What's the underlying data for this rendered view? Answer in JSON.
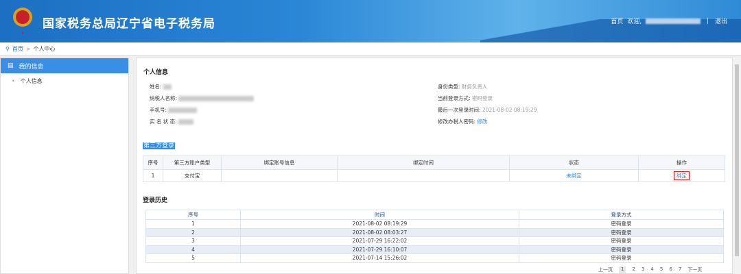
{
  "header": {
    "title": "国家税务总局辽宁省电子税务局",
    "emblem_text": "中国税务",
    "home": "首页",
    "welcome": "欢迎,",
    "logout": "退出"
  },
  "breadcrumb": {
    "home": "首页",
    "sep": ">",
    "current": "个人中心"
  },
  "sidebar": {
    "section": "我的信息",
    "items": [
      {
        "label": "个人信息"
      }
    ]
  },
  "personal": {
    "title": "个人信息",
    "left": [
      {
        "label": "姓名:"
      },
      {
        "label": "纳税人名称:"
      },
      {
        "label": "手机号:"
      },
      {
        "label": "实 名 状 态:"
      }
    ],
    "right": [
      {
        "label": "身份类型:",
        "value": "财务负责人"
      },
      {
        "label": "当前登录方式:",
        "value": "密码登录"
      },
      {
        "label": "最后一次登录时间:",
        "value": "2021-08-02 08:19:29"
      },
      {
        "label": "修改办税人密码:",
        "value": "修改"
      }
    ]
  },
  "third_party": {
    "title": "第三方登录",
    "headers": [
      "序号",
      "第三方账户类型",
      "绑定账号信息",
      "绑定时间",
      "状态",
      "操作"
    ],
    "rows": [
      {
        "no": "1",
        "type": "支付宝",
        "account": "",
        "time": "",
        "status": "未绑定",
        "action": "绑定"
      }
    ]
  },
  "history": {
    "title": "登录历史",
    "headers": [
      "序号",
      "时间",
      "登录方式"
    ],
    "rows": [
      {
        "no": "1",
        "time": "2021-08-02 08:19:29",
        "method": "密码登录"
      },
      {
        "no": "2",
        "time": "2021-08-02 08:03:27",
        "method": "密码登录"
      },
      {
        "no": "3",
        "time": "2021-07-29 16:22:02",
        "method": "密码登录"
      },
      {
        "no": "4",
        "time": "2021-07-29 16:10:07",
        "method": "密码登录"
      },
      {
        "no": "5",
        "time": "2021-07-14 15:26:02",
        "method": "密码登录"
      }
    ]
  },
  "pager": {
    "prev": "上一页",
    "pages": [
      "1",
      "2",
      "3",
      "4",
      "5",
      "6",
      "7"
    ],
    "next": "下一页",
    "current": "1"
  }
}
